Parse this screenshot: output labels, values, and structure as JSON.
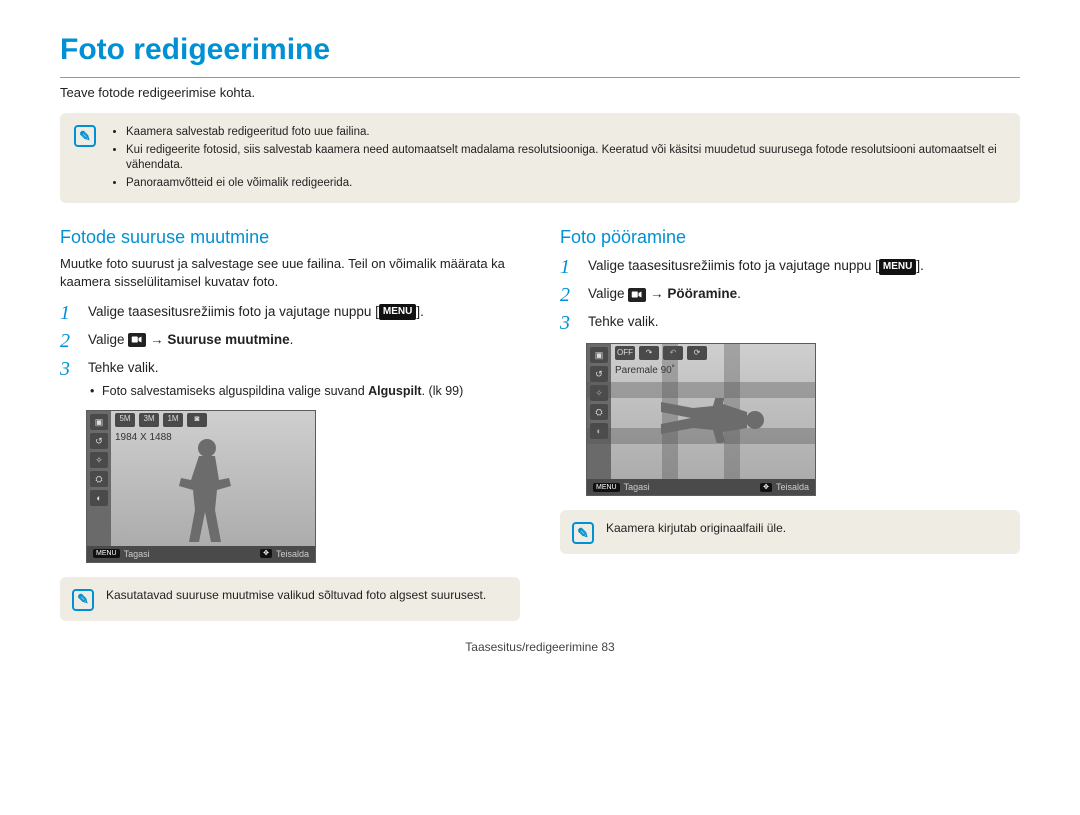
{
  "title": "Foto redigeerimine",
  "subtitle": "Teave fotode redigeerimise kohta.",
  "top_notes": [
    "Kaamera salvestab redigeeritud foto uue failina.",
    "Kui redigeerite fotosid, siis salvestab kaamera need automaatselt madalama resolutsiooniga. Keeratud või käsitsi muudetud suurusega fotode resolutsiooni automaatselt ei vähendata.",
    "Panoraamvõtteid ei ole võimalik redigeerida."
  ],
  "left": {
    "heading": "Fotode suuruse muutmine",
    "intro": "Muutke foto suurust ja salvestage see uue failina. Teil on võimalik määrata ka kaamera sisselülitamisel kuvatav foto.",
    "step1_a": "Valige taasesitusrežiimis foto ja vajutage nuppu [",
    "step1_b": "].",
    "step2_a": "Valige ",
    "step2_b": " → ",
    "step2_bold": "Suuruse muutmine",
    "step2_end": ".",
    "step3": "Tehke valik.",
    "bullet_a": "Foto salvestamiseks alguspildina valige suvand ",
    "bullet_bold": "Alguspilt",
    "bullet_b": ". (lk 99)",
    "shot_label": "1984 X 1488",
    "shot_back": "Tagasi",
    "shot_move": "Teisalda",
    "note": "Kasutatavad suuruse muutmise valikud sõltuvad foto algsest suurusest."
  },
  "right": {
    "heading": "Foto pööramine",
    "step1_a": "Valige taasesitusrežiimis foto ja vajutage nuppu [",
    "step1_b": "].",
    "step2_a": "Valige ",
    "step2_b": " → ",
    "step2_bold": "Pööramine",
    "step2_end": ".",
    "step3": "Tehke valik.",
    "shot_label": "Paremale 90˚",
    "shot_back": "Tagasi",
    "shot_move": "Teisalda",
    "note": "Kaamera kirjutab originaalfaili üle."
  },
  "menu_label": "MENU",
  "footer": "Taasesitus/redigeerimine  83"
}
